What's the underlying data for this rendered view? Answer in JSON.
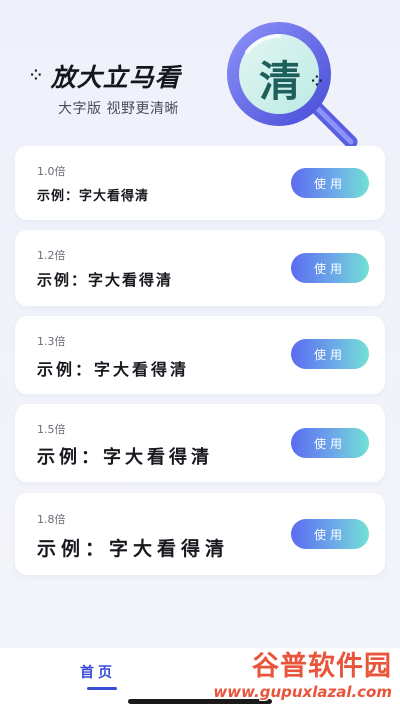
{
  "hero": {
    "title": "放大立马看",
    "decor_left": "⁘",
    "decor_right": "⁘",
    "subtitle": "大字版 视野更清晰",
    "magnifier_char": "清"
  },
  "cards": [
    {
      "multiplier": "1.0倍",
      "example": "示例：字大看得清",
      "button": "使用"
    },
    {
      "multiplier": "1.2倍",
      "example": "示例：字大看得清",
      "button": "使用"
    },
    {
      "multiplier": "1.3倍",
      "example": "示例：字大看得清",
      "button": "使用"
    },
    {
      "multiplier": "1.5倍",
      "example": "示例：字大看得清",
      "button": "使用"
    },
    {
      "multiplier": "1.8倍",
      "example": "示例：字大看得清",
      "button": "使用"
    }
  ],
  "tabbar": {
    "home_label": "首页"
  },
  "watermark": {
    "brand": "谷普软件园",
    "url": "www.gupuxlazal.com"
  },
  "colors": {
    "accent": "#3a4bd8",
    "button_start": "#5b6cf0",
    "button_end": "#72e0d4",
    "watermark": "#e8553a"
  }
}
